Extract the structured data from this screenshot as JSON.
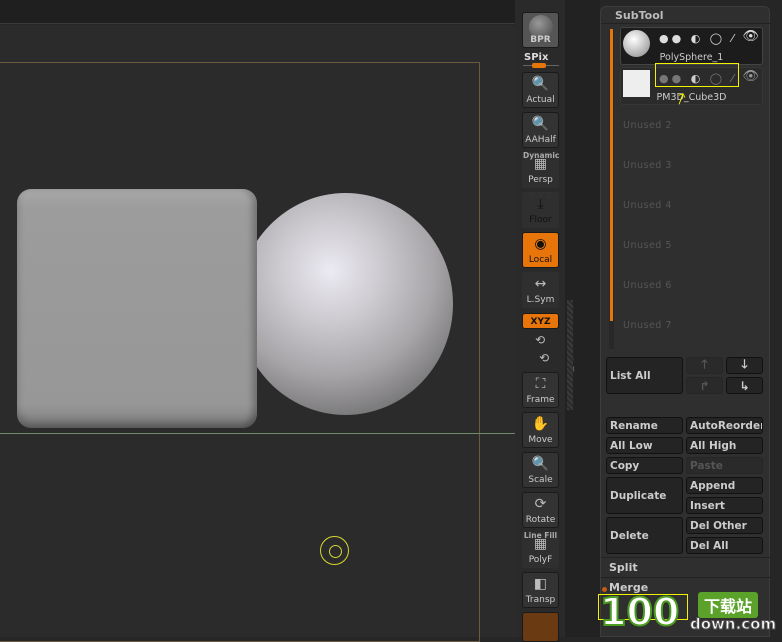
{
  "toolbar": {
    "bpr": "BPR",
    "spix": "SPix",
    "buttons": [
      {
        "label": "Actual",
        "icon": "zoom-actual-icon",
        "active": false
      },
      {
        "label": "AAHalf",
        "icon": "zoom-aahalf-icon",
        "active": false
      },
      {
        "label": "Persp",
        "icon": "perspective-grid-icon",
        "overlay": "Dynamic",
        "active": false
      },
      {
        "label": "Floor",
        "icon": "floor-icon",
        "overlay": "X Y Z",
        "active": true
      },
      {
        "label": "Local",
        "icon": "local-rotate-icon",
        "active": true
      },
      {
        "label": "L.Sym",
        "icon": "local-symmetry-icon",
        "active": false
      },
      {
        "label": "XYZ",
        "icon": "rotate-xyz-icon",
        "active": true
      },
      {
        "label": "Frame",
        "icon": "frame-icon",
        "active": false
      },
      {
        "label": "Move",
        "icon": "move-hand-icon",
        "active": false
      },
      {
        "label": "Scale",
        "icon": "scale-icon",
        "active": false
      },
      {
        "label": "Rotate",
        "icon": "rotate-icon",
        "active": false
      },
      {
        "label": "PolyF",
        "icon": "polyframe-icon",
        "overlay": "Line Fill",
        "active": false
      },
      {
        "label": "Transp",
        "icon": "transparency-icon",
        "active": false
      }
    ],
    "accent": "#e8750a"
  },
  "subtool": {
    "title": "SubTool",
    "items": [
      {
        "name": "PolySphere_1",
        "selected": true
      },
      {
        "name": "PM3D_Cube3D",
        "selected": false
      }
    ],
    "unused": [
      "Unused  2",
      "Unused  3",
      "Unused  4",
      "Unused  5",
      "Unused  6",
      "Unused  7"
    ],
    "list_all": "List All",
    "buttons": {
      "rename": "Rename",
      "auto_reorder": "AutoReorder",
      "all_low": "All Low",
      "all_high": "All High",
      "copy": "Copy",
      "paste": "Paste",
      "duplicate": "Duplicate",
      "append": "Append",
      "insert": "Insert",
      "delete": "Delete",
      "del_other": "Del Other",
      "del_all": "Del All"
    },
    "split": "Split",
    "merge": "Merge"
  },
  "watermark": {
    "logo": "100",
    "tag": "下载站",
    "domain": "down.com"
  },
  "highlight_color": "#f2f200"
}
